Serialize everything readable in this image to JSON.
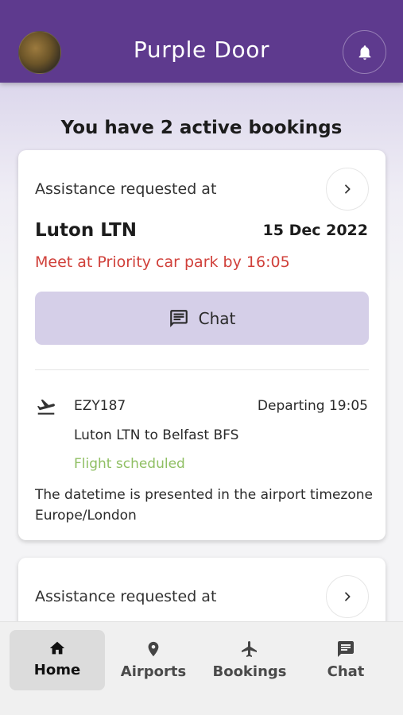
{
  "header": {
    "title": "Purple Door",
    "avatar": "user-avatar",
    "notification_icon": "bell-icon"
  },
  "page": {
    "heading": "You have 2 active bookings"
  },
  "bookings": [
    {
      "assistance_label": "Assistance  requested at",
      "airport": "Luton LTN",
      "date": "15 Dec 2022",
      "meeting_note": "Meet at Priority car park by 16:05",
      "chat_label": "Chat",
      "flight": {
        "number": "EZY187",
        "departing": "Departing 19:05",
        "route": "Luton LTN to Belfast BFS",
        "status": "Flight scheduled"
      },
      "timezone_note": "The datetime is presented in the airport timezone Europe/London"
    },
    {
      "assistance_label": "Assistance  requested at"
    }
  ],
  "nav": {
    "items": [
      {
        "label": "Home",
        "icon": "home-icon",
        "active": true
      },
      {
        "label": "Airports",
        "icon": "location-pin-icon",
        "active": false
      },
      {
        "label": "Bookings",
        "icon": "airplane-icon",
        "active": false
      },
      {
        "label": "Chat",
        "icon": "chat-bubble-icon",
        "active": false
      }
    ]
  },
  "colors": {
    "header": "#5e3a8e",
    "chat_button": "#d5cfe8",
    "alert_text": "#d0403a",
    "status_text": "#8fbf63"
  }
}
